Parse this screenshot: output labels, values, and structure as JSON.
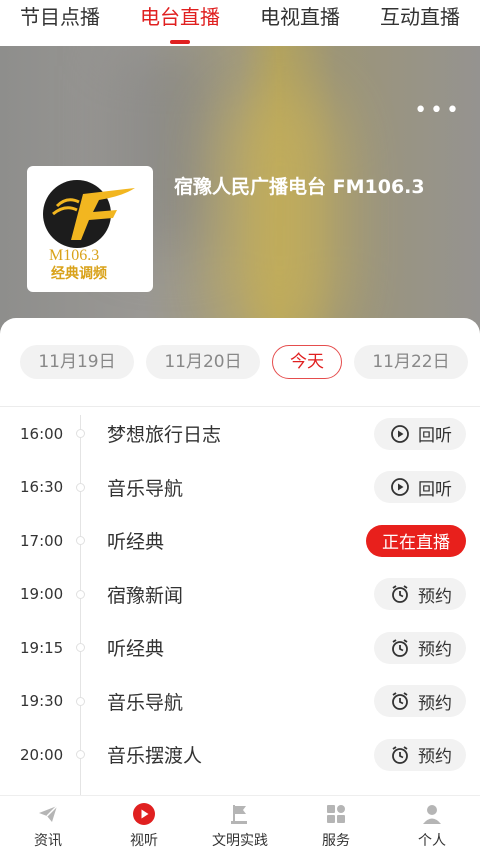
{
  "top_tabs": [
    {
      "label": "节目点播",
      "active": false
    },
    {
      "label": "电台直播",
      "active": true
    },
    {
      "label": "电视直播",
      "active": false
    },
    {
      "label": "互动直播",
      "active": false
    }
  ],
  "hero": {
    "station_name": "宿豫人民广播电台 FM106.3",
    "logo_text": "M106.3",
    "logo_subtitle": "经典调频",
    "more_icon": "more-icon"
  },
  "dates": [
    {
      "label": "11月19日",
      "selected": false
    },
    {
      "label": "11月20日",
      "selected": false
    },
    {
      "label": "今天",
      "selected": true
    },
    {
      "label": "11月22日",
      "selected": false
    }
  ],
  "schedule": [
    {
      "time": "16:00",
      "title": "梦想旅行日志",
      "action": "回听",
      "action_type": "replay"
    },
    {
      "time": "16:30",
      "title": "音乐导航",
      "action": "回听",
      "action_type": "replay"
    },
    {
      "time": "17:00",
      "title": "听经典",
      "action": "正在直播",
      "action_type": "live"
    },
    {
      "time": "19:00",
      "title": "宿豫新闻",
      "action": "预约",
      "action_type": "reserve"
    },
    {
      "time": "19:15",
      "title": "听经典",
      "action": "预约",
      "action_type": "reserve"
    },
    {
      "time": "19:30",
      "title": "音乐导航",
      "action": "预约",
      "action_type": "reserve"
    },
    {
      "time": "20:00",
      "title": "音乐摆渡人",
      "action": "预约",
      "action_type": "reserve"
    }
  ],
  "bottom_nav": [
    {
      "label": "资讯",
      "icon": "paper-plane-icon",
      "active": false
    },
    {
      "label": "视听",
      "icon": "play-circle-icon",
      "active": true
    },
    {
      "label": "文明实践",
      "icon": "flag-icon",
      "active": false
    },
    {
      "label": "服务",
      "icon": "grid-icon",
      "active": false
    },
    {
      "label": "个人",
      "icon": "person-icon",
      "active": false
    }
  ],
  "colors": {
    "accent": "#e02020",
    "live": "#e8201c",
    "logo_gold": "#f2b620"
  }
}
